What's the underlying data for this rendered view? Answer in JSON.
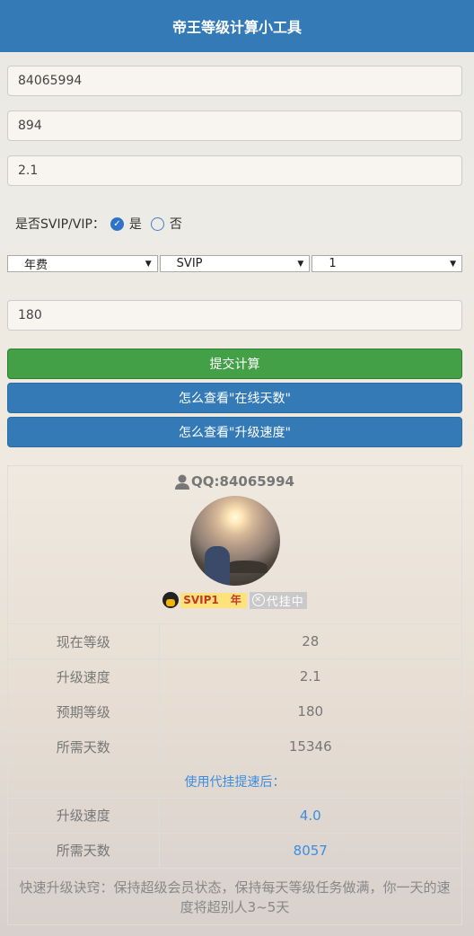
{
  "header": {
    "title": "帝王等级计算小工具"
  },
  "inputs": {
    "qq": "84065994",
    "days": "894",
    "speed": "2.1",
    "target_level": "180"
  },
  "vip": {
    "question": "是否SVIP/VIP：",
    "yes": "是",
    "no": "否",
    "selected": "yes"
  },
  "selects": {
    "period": "年费",
    "type": "SVIP",
    "level": "1"
  },
  "buttons": {
    "submit": "提交计算",
    "howto_days": "怎么查看\"在线天数\"",
    "howto_speed": "怎么查看\"升级速度\""
  },
  "profile": {
    "qq_label": "QQ:84065994",
    "svip_badge": "SVIP1",
    "year_badge": "年",
    "status_badge": "代挂中"
  },
  "results": [
    {
      "label": "现在等级",
      "value": "28"
    },
    {
      "label": "升级速度",
      "value": "2.1"
    },
    {
      "label": "预期等级",
      "value": "180"
    },
    {
      "label": "所需天数",
      "value": "15346"
    }
  ],
  "speedup": {
    "heading": "使用代挂提速后：",
    "rows": [
      {
        "label": "升级速度",
        "value": "4.0"
      },
      {
        "label": "所需天数",
        "value": "8057"
      }
    ]
  },
  "tip": "快速升级诀窍：保持超级会员状态，保持每天等级任务做满，你一天的速度将超别人3~5天",
  "colors": {
    "header": "#337ab7",
    "submit": "#43a047",
    "blue_button": "#337ab7",
    "accent_text": "#3c8de0"
  }
}
